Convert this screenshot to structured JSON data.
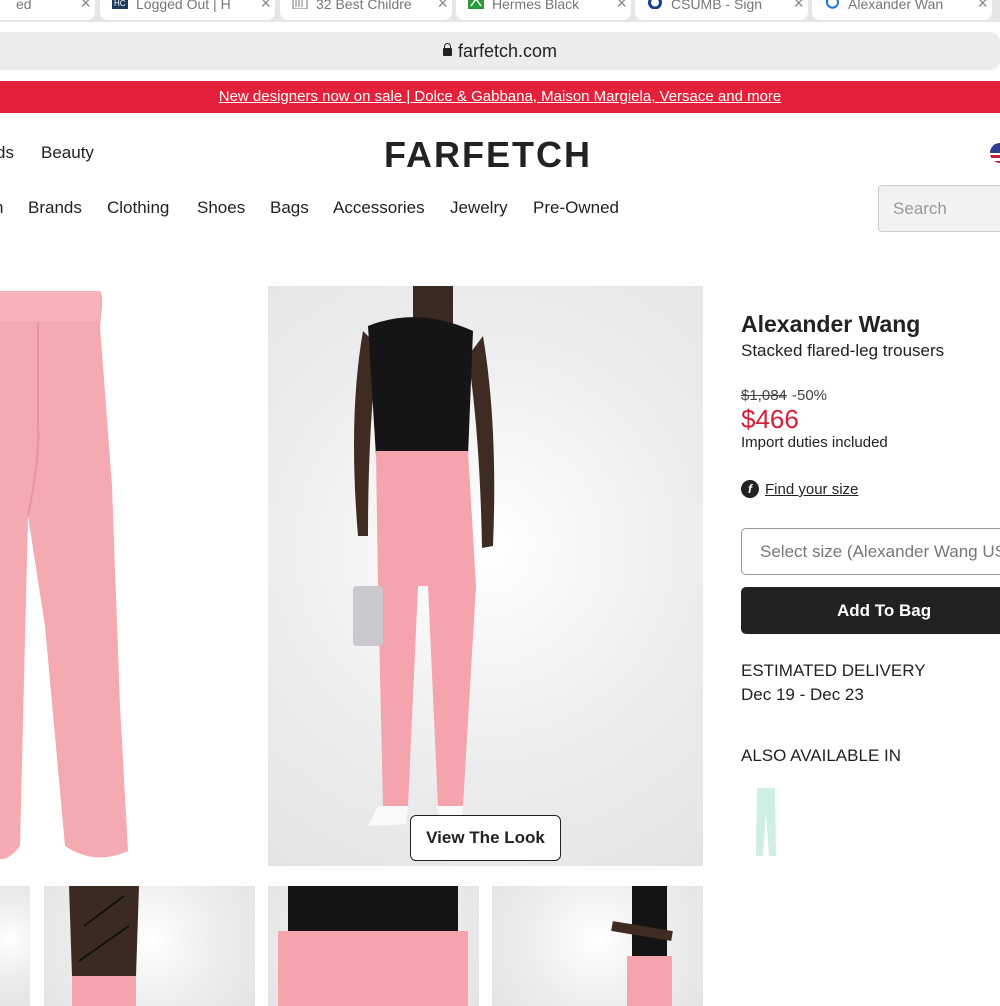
{
  "browser": {
    "tabs": [
      {
        "title": "ed",
        "favicon": "page-icon"
      },
      {
        "title": "Logged Out | H",
        "favicon": "hc-icon"
      },
      {
        "title": "32 Best Childre",
        "favicon": "doc-icon"
      },
      {
        "title": "Hermes Black",
        "favicon": "hermes-icon"
      },
      {
        "title": "CSUMB - Sign",
        "favicon": "csumb-icon"
      },
      {
        "title": "Alexander Wan",
        "favicon": "loading-icon"
      }
    ],
    "url": "farfetch.com"
  },
  "promo": {
    "text": "New designers now on sale | Dolce & Gabbana, Maison Margiela, Versace and more",
    "color": "#e4203a"
  },
  "header": {
    "top_nav": [
      "ds",
      "Beauty"
    ],
    "logo": "FARFETCH",
    "categories": [
      "n",
      "Brands",
      "Clothing",
      "Shoes",
      "Bags",
      "Accessories",
      "Jewelry",
      "Pre-Owned"
    ],
    "search_placeholder": "Search"
  },
  "gallery": {
    "view_the_look": "View The Look"
  },
  "product": {
    "brand": "Alexander Wang",
    "name": "Stacked flared-leg trousers",
    "original_price": "$1,084",
    "discount": "-50%",
    "price": "$466",
    "price_color": "#d0203a",
    "duties": "Import duties included",
    "find_size": "Find your size",
    "size_placeholder": "Select size (Alexander Wang US)",
    "add_to_bag": "Add To Bag",
    "delivery_label": "ESTIMATED DELIVERY",
    "delivery_dates": "Dec 19 - Dec 23",
    "also_available": "ALSO AVAILABLE IN"
  }
}
